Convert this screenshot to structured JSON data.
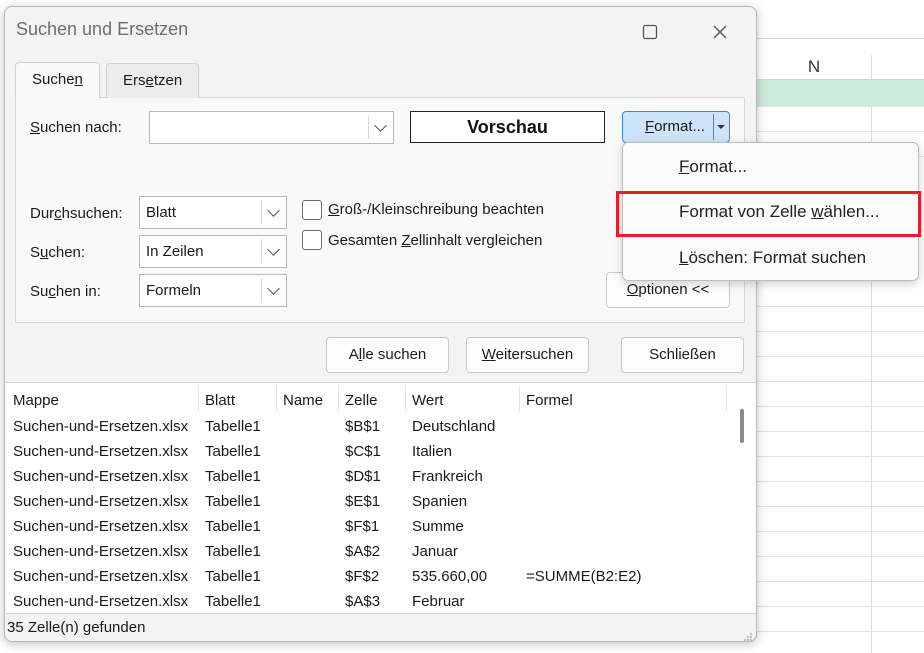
{
  "spreadsheet": {
    "column_header": "N"
  },
  "dialog": {
    "title": "Suchen und Ersetzen",
    "tabs": [
      {
        "label_pre": "Suche",
        "label_u": "n",
        "label_post": ""
      },
      {
        "label_pre": "Ers",
        "label_u": "e",
        "label_post": "tzen"
      }
    ],
    "find_what": {
      "label_pre": "",
      "label_u": "S",
      "label_post": "uchen nach:",
      "value": ""
    },
    "preview": "Vorschau",
    "format_button": {
      "label_pre": "",
      "label_u": "F",
      "label_post": "ormat..."
    },
    "within": {
      "label_pre": "Dur",
      "label_u": "c",
      "label_post": "hsuchen:",
      "value": "Blatt"
    },
    "search": {
      "label_pre": "S",
      "label_u": "u",
      "label_post": "chen:",
      "value": "In Zeilen"
    },
    "look_in": {
      "label_pre": "Su",
      "label_u": "c",
      "label_post": "hen in:",
      "value": "Formeln"
    },
    "match_case": {
      "label_pre": "",
      "label_u": "G",
      "label_post": "roß-/Kleinschreibung beachten"
    },
    "entire_cell": {
      "label_pre": "Gesamten ",
      "label_u": "Z",
      "label_post": "ellinhalt vergleichen"
    },
    "options_button": {
      "label_pre": "",
      "label_u": "O",
      "label_post": "ptionen <<"
    },
    "find_all": {
      "label_pre": "A",
      "label_u": "l",
      "label_post": "le suchen"
    },
    "find_next": {
      "label_pre": "",
      "label_u": "W",
      "label_post": "eitersuchen"
    },
    "close": {
      "label": "Schließen"
    },
    "results": {
      "columns": [
        "Mappe",
        "Blatt",
        "Name",
        "Zelle",
        "Wert",
        "Formel"
      ],
      "rows": [
        [
          "Suchen-und-Ersetzen.xlsx",
          "Tabelle1",
          "",
          "$B$1",
          "Deutschland",
          ""
        ],
        [
          "Suchen-und-Ersetzen.xlsx",
          "Tabelle1",
          "",
          "$C$1",
          "Italien",
          ""
        ],
        [
          "Suchen-und-Ersetzen.xlsx",
          "Tabelle1",
          "",
          "$D$1",
          "Frankreich",
          ""
        ],
        [
          "Suchen-und-Ersetzen.xlsx",
          "Tabelle1",
          "",
          "$E$1",
          "Spanien",
          ""
        ],
        [
          "Suchen-und-Ersetzen.xlsx",
          "Tabelle1",
          "",
          "$F$1",
          "Summe",
          ""
        ],
        [
          "Suchen-und-Ersetzen.xlsx",
          "Tabelle1",
          "",
          "$A$2",
          "Januar",
          ""
        ],
        [
          "Suchen-und-Ersetzen.xlsx",
          "Tabelle1",
          "",
          "$F$2",
          "535.660,00",
          "=SUMME(B2:E2)"
        ],
        [
          "Suchen-und-Ersetzen.xlsx",
          "Tabelle1",
          "",
          "$A$3",
          "Februar",
          ""
        ]
      ]
    },
    "status": "35 Zelle(n) gefunden"
  },
  "format_menu": {
    "items": [
      {
        "label_pre": "",
        "label_u": "F",
        "label_post": "ormat..."
      },
      {
        "label_pre": "Format von Zelle ",
        "label_u": "w",
        "label_post": "ählen..."
      },
      {
        "label_pre": "",
        "label_u": "L",
        "label_post": "öschen: Format suchen"
      }
    ]
  },
  "colors": {
    "highlight": "#e0202b",
    "accent": "#3a8ad6",
    "selection_green": "#cdebd9"
  },
  "icons": [
    "maximize-icon",
    "close-icon",
    "chevron-down-icon",
    "dropdown-arrow-icon",
    "resize-grip-icon"
  ]
}
